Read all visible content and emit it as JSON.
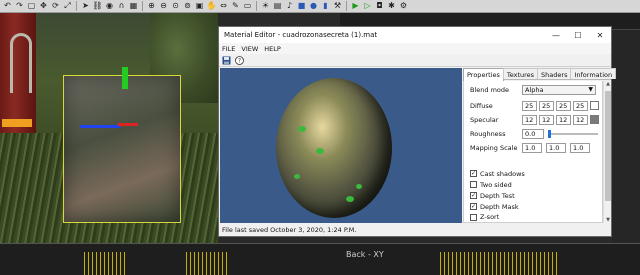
{
  "toolbar": {
    "icons": [
      "undo-icon",
      "redo-icon",
      "select-icon",
      "move-icon",
      "rotate-icon",
      "scale-icon",
      "pointer-icon",
      "link-icon",
      "camera-icon",
      "magnet-icon",
      "grid-icon",
      "zoom-in-icon",
      "zoom-out-icon",
      "zoom-fit-icon",
      "zoom-all-icon",
      "frame-icon",
      "hand-icon",
      "pan-icon",
      "brush-icon",
      "eraser-icon",
      "light-icon",
      "volume-icon",
      "sound-icon",
      "cube-icon",
      "sphere-icon",
      "cylinder-icon",
      "build-icon",
      "play-icon",
      "play-debug-icon",
      "camera-snap-icon",
      "settings-icon",
      "gear-icon"
    ]
  },
  "viewports": {
    "top_right_label": "",
    "bottom_right_label": "Back - XY"
  },
  "dialog": {
    "title": "Material Editor - cuadrozonasecreta (1).mat",
    "window_buttons": {
      "minimize": "—",
      "maximize": "☐",
      "close": "✕"
    },
    "menu": [
      "FILE",
      "VIEW",
      "HELP"
    ],
    "status": "File last saved October 3, 2020, 1:24 P.M.",
    "tabs": [
      "Properties",
      "Textures",
      "Shaders",
      "Information"
    ],
    "properties": {
      "blend_mode_label": "Blend mode",
      "blend_mode_value": "Alpha",
      "diffuse_label": "Diffuse",
      "diffuse_values": [
        "25",
        "25",
        "25",
        "25"
      ],
      "specular_label": "Specular",
      "specular_values": [
        "12",
        "12",
        "12",
        "12"
      ],
      "roughness_label": "Roughness",
      "roughness_value": "0.0",
      "mapping_scale_label": "Mapping Scale",
      "mapping_scale_values": [
        "1.0",
        "1.0",
        "1.0"
      ],
      "checkboxes": [
        {
          "label": "Cast shadows",
          "checked": true
        },
        {
          "label": "Two sided",
          "checked": false
        },
        {
          "label": "Depth Test",
          "checked": true
        },
        {
          "label": "Depth Mask",
          "checked": true
        },
        {
          "label": "Z-sort",
          "checked": false
        }
      ]
    }
  },
  "colors": {
    "preview_bg": "#3a5a8a",
    "diffuse_swatch": "#ffffff",
    "specular_swatch": "#7a7a7a",
    "selection": "#d8d83a",
    "gizmo_y": "#22cc22",
    "gizmo_z": "#2244ee",
    "gizmo_x": "#dd2222"
  }
}
